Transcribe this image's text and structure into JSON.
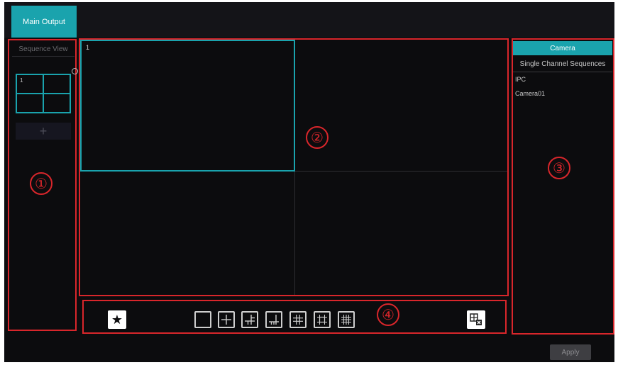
{
  "tabs": {
    "main_output": "Main Output"
  },
  "left_panel": {
    "header": "Sequence View",
    "thumbnail_number": "1",
    "add_symbol": "+"
  },
  "video_area": {
    "active_cell_number": "1"
  },
  "right_panel": {
    "tabs": [
      "Camera",
      "Single Channel Sequences"
    ],
    "tree": [
      "IPC",
      "Camera01"
    ]
  },
  "markers": [
    "①",
    "②",
    "③",
    "④"
  ],
  "toolbar": {
    "favorite_icon": "star-icon",
    "layouts": [
      "1-screen",
      "4-screen",
      "6-screen",
      "8-screen",
      "9-screen",
      "13-screen",
      "16-screen"
    ],
    "clear_icon": "clear-layout-icon"
  },
  "footer": {
    "apply_label": "Apply"
  },
  "colors": {
    "accent": "#1aa3ad",
    "annotation": "#d9262b",
    "background": "#0c0c0e"
  }
}
